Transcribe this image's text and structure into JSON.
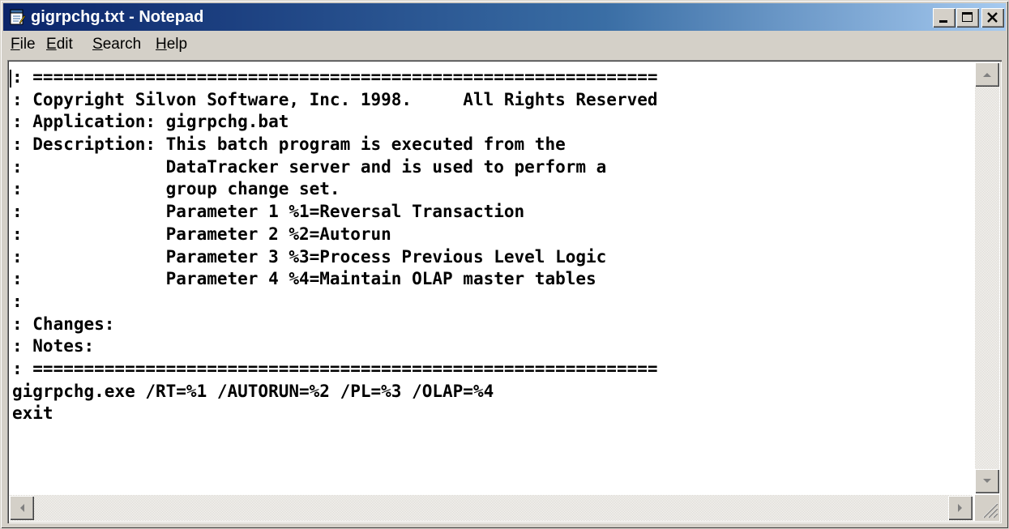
{
  "window": {
    "title": "gigrpchg.txt - Notepad"
  },
  "icons": {
    "app": "notepad-icon",
    "minimize": "minimize-icon",
    "maximize": "maximize-icon",
    "close": "close-icon",
    "scroll_up": "arrow-up-icon",
    "scroll_down": "arrow-down-icon",
    "scroll_left": "arrow-left-icon",
    "scroll_right": "arrow-right-icon",
    "size_grip": "size-grip-icon"
  },
  "menu": {
    "items": [
      {
        "underline": "F",
        "rest": "ile"
      },
      {
        "underline": "E",
        "rest": "dit"
      },
      {
        "underline": "S",
        "rest": "earch"
      },
      {
        "underline": "H",
        "rest": "elp"
      }
    ]
  },
  "editor": {
    "lines": [
      ": =============================================================",
      ": Copyright Silvon Software, Inc. 1998.     All Rights Reserved",
      ": Application: gigrpchg.bat",
      ": Description: This batch program is executed from the",
      ":              DataTracker server and is used to perform a",
      ":              group change set.",
      ":              Parameter 1 %1=Reversal Transaction",
      ":              Parameter 2 %2=Autorun",
      ":              Parameter 3 %3=Process Previous Level Logic",
      ":              Parameter 4 %4=Maintain OLAP master tables",
      ":",
      ": Changes:",
      ": Notes:",
      ": =============================================================",
      "gigrpchg.exe /RT=%1 /AUTORUN=%2 /PL=%3 /OLAP=%4",
      "exit"
    ]
  },
  "colors": {
    "title_gradient_start": "#0a246a",
    "title_gradient_end": "#a6caf0",
    "chrome": "#d4d0c8"
  }
}
